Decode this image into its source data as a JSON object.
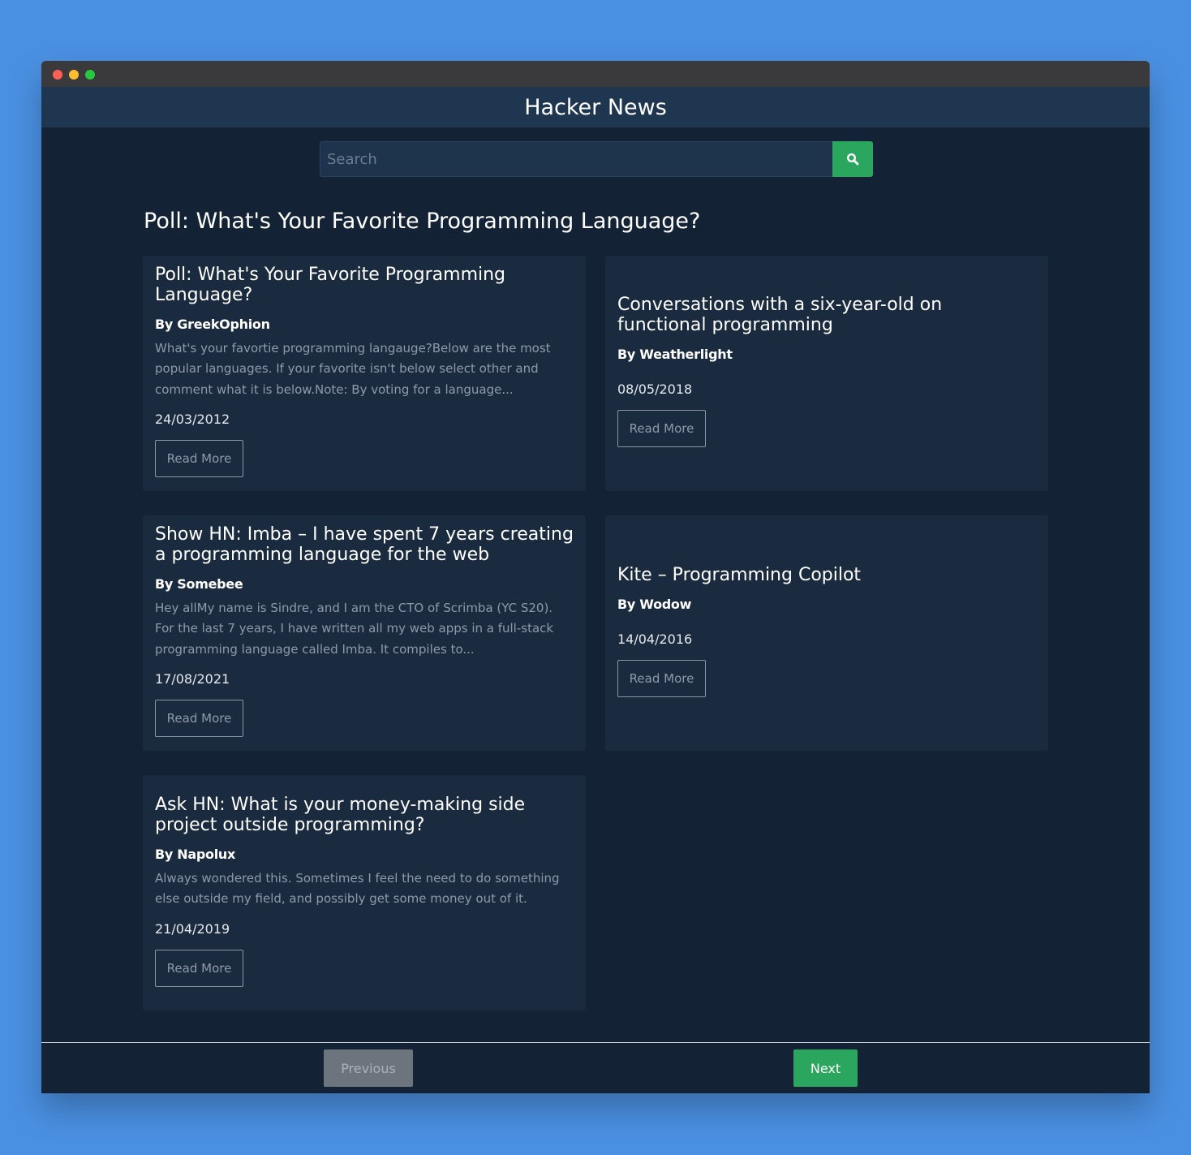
{
  "app": {
    "title": "Hacker News"
  },
  "search": {
    "placeholder": "Search",
    "value": "",
    "icon": "search-icon"
  },
  "heading": "Poll: What's Your Favorite Programming Language?",
  "stories": [
    {
      "title": "Poll: What's Your Favorite Programming Language?",
      "author": "By GreekOphion",
      "text": "What's your favortie programming langauge?Below are the most popular languages. If your favorite isn't below select other and comment what it is below.Note: By voting for a language...",
      "date": "24/03/2012",
      "button": "Read More"
    },
    {
      "title": "Conversations with a six-year-old on functional programming",
      "author": "By Weatherlight",
      "text": "",
      "date": "08/05/2018",
      "button": "Read More"
    },
    {
      "title": "Show HN: Imba – I have spent 7 years creating a programming language for the web",
      "author": "By Somebee",
      "text": "Hey allMy name is Sindre, and I am the CTO of Scrimba (YC S20). For the last 7 years, I have written all my web apps in a full-stack programming language called Imba. It compiles to...",
      "date": "17/08/2021",
      "button": "Read More"
    },
    {
      "title": "Kite – Programming Copilot",
      "author": "By Wodow",
      "text": "",
      "date": "14/04/2016",
      "button": "Read More"
    },
    {
      "title": "Ask HN: What is your money-making side project outside programming?",
      "author": "By Napolux",
      "text": "Always wondered this. Sometimes I feel the need to do something else outside my field, and possibly get some money out of it.",
      "date": "21/04/2019",
      "button": "Read More"
    }
  ],
  "pagination": {
    "previous": "Previous",
    "next": "Next"
  },
  "colors": {
    "accent": "#2aa65e",
    "background": "#132234",
    "card": "#1b2b3f",
    "header": "#1e364f"
  }
}
